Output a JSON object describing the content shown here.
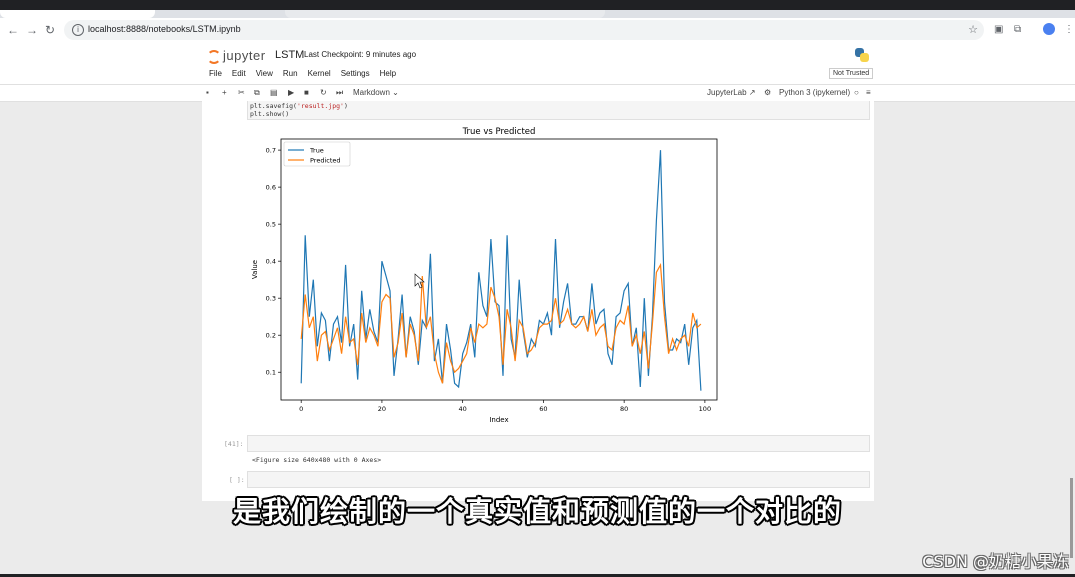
{
  "browser": {
    "url": "localhost:8888/notebooks/LSTM.ipynb",
    "nav_back": "←",
    "nav_forward": "→",
    "nav_reload": "↻"
  },
  "jupyter": {
    "logo_text": "jupyter",
    "notebook_title": "LSTM",
    "checkpoint": "Last Checkpoint: 9 minutes ago",
    "menu": [
      "File",
      "Edit",
      "View",
      "Run",
      "Kernel",
      "Settings",
      "Help"
    ],
    "trust_badge": "Not Trusted",
    "cell_type": "Markdown",
    "jupyterlab_link": "JupyterLab",
    "kernel_name": "Python 3 (ipykernel)"
  },
  "cells": {
    "code_line1": "plt.savefig(",
    "code_line1_str": "'result.jpg'",
    "code_line1_end": ")",
    "code_line2": "plt.show()",
    "prompt_41": "[41]:",
    "output_text": "<Figure size 640x480 with 0 Axes>",
    "prompt_empty": "[ ]:"
  },
  "chart_data": {
    "type": "line",
    "title": "True vs Predicted",
    "xlabel": "Index",
    "ylabel": "Value",
    "xlim": [
      -5,
      103
    ],
    "ylim": [
      0.025,
      0.73
    ],
    "xticks": [
      0,
      20,
      40,
      60,
      80,
      100
    ],
    "yticks": [
      0.1,
      0.2,
      0.3,
      0.4,
      0.5,
      0.6,
      0.7
    ],
    "grid": false,
    "legend_position": "top-left",
    "series": [
      {
        "name": "True",
        "color": "#1f77b4",
        "x": [
          0,
          1,
          2,
          3,
          4,
          5,
          6,
          7,
          8,
          9,
          10,
          11,
          12,
          13,
          14,
          15,
          16,
          17,
          18,
          19,
          20,
          21,
          22,
          23,
          24,
          25,
          26,
          27,
          28,
          29,
          30,
          31,
          32,
          33,
          34,
          35,
          36,
          37,
          38,
          39,
          40,
          41,
          42,
          43,
          44,
          45,
          46,
          47,
          48,
          49,
          50,
          51,
          52,
          53,
          54,
          55,
          56,
          57,
          58,
          59,
          60,
          61,
          62,
          63,
          64,
          65,
          66,
          67,
          68,
          69,
          70,
          71,
          72,
          73,
          74,
          75,
          76,
          77,
          78,
          79,
          80,
          81,
          82,
          83,
          84,
          85,
          86,
          87,
          88,
          89,
          90,
          91,
          92,
          93,
          94,
          95,
          96,
          97,
          98,
          99
        ],
        "values": [
          0.07,
          0.47,
          0.25,
          0.35,
          0.17,
          0.26,
          0.24,
          0.13,
          0.23,
          0.25,
          0.18,
          0.39,
          0.17,
          0.23,
          0.08,
          0.32,
          0.19,
          0.27,
          0.21,
          0.18,
          0.4,
          0.36,
          0.32,
          0.09,
          0.19,
          0.31,
          0.14,
          0.25,
          0.21,
          0.12,
          0.24,
          0.22,
          0.42,
          0.13,
          0.19,
          0.07,
          0.23,
          0.16,
          0.07,
          0.06,
          0.15,
          0.18,
          0.23,
          0.14,
          0.37,
          0.28,
          0.25,
          0.46,
          0.29,
          0.28,
          0.09,
          0.47,
          0.19,
          0.14,
          0.35,
          0.21,
          0.14,
          0.19,
          0.17,
          0.24,
          0.23,
          0.26,
          0.2,
          0.46,
          0.22,
          0.29,
          0.34,
          0.23,
          0.23,
          0.25,
          0.25,
          0.21,
          0.34,
          0.23,
          0.26,
          0.27,
          0.15,
          0.12,
          0.25,
          0.26,
          0.32,
          0.34,
          0.17,
          0.22,
          0.06,
          0.3,
          0.09,
          0.25,
          0.51,
          0.7,
          0.29,
          0.16,
          0.16,
          0.19,
          0.18,
          0.23,
          0.12,
          0.22,
          0.24,
          0.05
        ]
      },
      {
        "name": "Predicted",
        "color": "#ff7f0e",
        "x": [
          0,
          1,
          2,
          3,
          4,
          5,
          6,
          7,
          8,
          9,
          10,
          11,
          12,
          13,
          14,
          15,
          16,
          17,
          18,
          19,
          20,
          21,
          22,
          23,
          24,
          25,
          26,
          27,
          28,
          29,
          30,
          31,
          32,
          33,
          34,
          35,
          36,
          37,
          38,
          39,
          40,
          41,
          42,
          43,
          44,
          45,
          46,
          47,
          48,
          49,
          50,
          51,
          52,
          53,
          54,
          55,
          56,
          57,
          58,
          59,
          60,
          61,
          62,
          63,
          64,
          65,
          66,
          67,
          68,
          69,
          70,
          71,
          72,
          73,
          74,
          75,
          76,
          77,
          78,
          79,
          80,
          81,
          82,
          83,
          84,
          85,
          86,
          87,
          88,
          89,
          90,
          91,
          92,
          93,
          94,
          95,
          96,
          97,
          98,
          99
        ],
        "values": [
          0.19,
          0.31,
          0.22,
          0.25,
          0.13,
          0.2,
          0.21,
          0.16,
          0.19,
          0.22,
          0.15,
          0.25,
          0.18,
          0.19,
          0.12,
          0.26,
          0.18,
          0.22,
          0.2,
          0.17,
          0.29,
          0.31,
          0.3,
          0.14,
          0.18,
          0.26,
          0.14,
          0.23,
          0.2,
          0.13,
          0.36,
          0.22,
          0.25,
          0.15,
          0.1,
          0.07,
          0.18,
          0.13,
          0.1,
          0.11,
          0.13,
          0.15,
          0.22,
          0.18,
          0.23,
          0.22,
          0.23,
          0.33,
          0.3,
          0.25,
          0.12,
          0.27,
          0.22,
          0.13,
          0.24,
          0.22,
          0.15,
          0.16,
          0.18,
          0.22,
          0.23,
          0.23,
          0.24,
          0.3,
          0.23,
          0.24,
          0.27,
          0.23,
          0.22,
          0.23,
          0.25,
          0.21,
          0.27,
          0.2,
          0.22,
          0.23,
          0.17,
          0.16,
          0.22,
          0.24,
          0.23,
          0.28,
          0.17,
          0.2,
          0.15,
          0.21,
          0.11,
          0.23,
          0.37,
          0.39,
          0.25,
          0.15,
          0.19,
          0.16,
          0.19,
          0.2,
          0.17,
          0.26,
          0.22,
          0.23
        ]
      }
    ]
  },
  "overlay": {
    "subtitle": "是我们绘制的一个真实值和预测值的一个对比的",
    "watermark": "CSDN @奶糖小果冻"
  }
}
